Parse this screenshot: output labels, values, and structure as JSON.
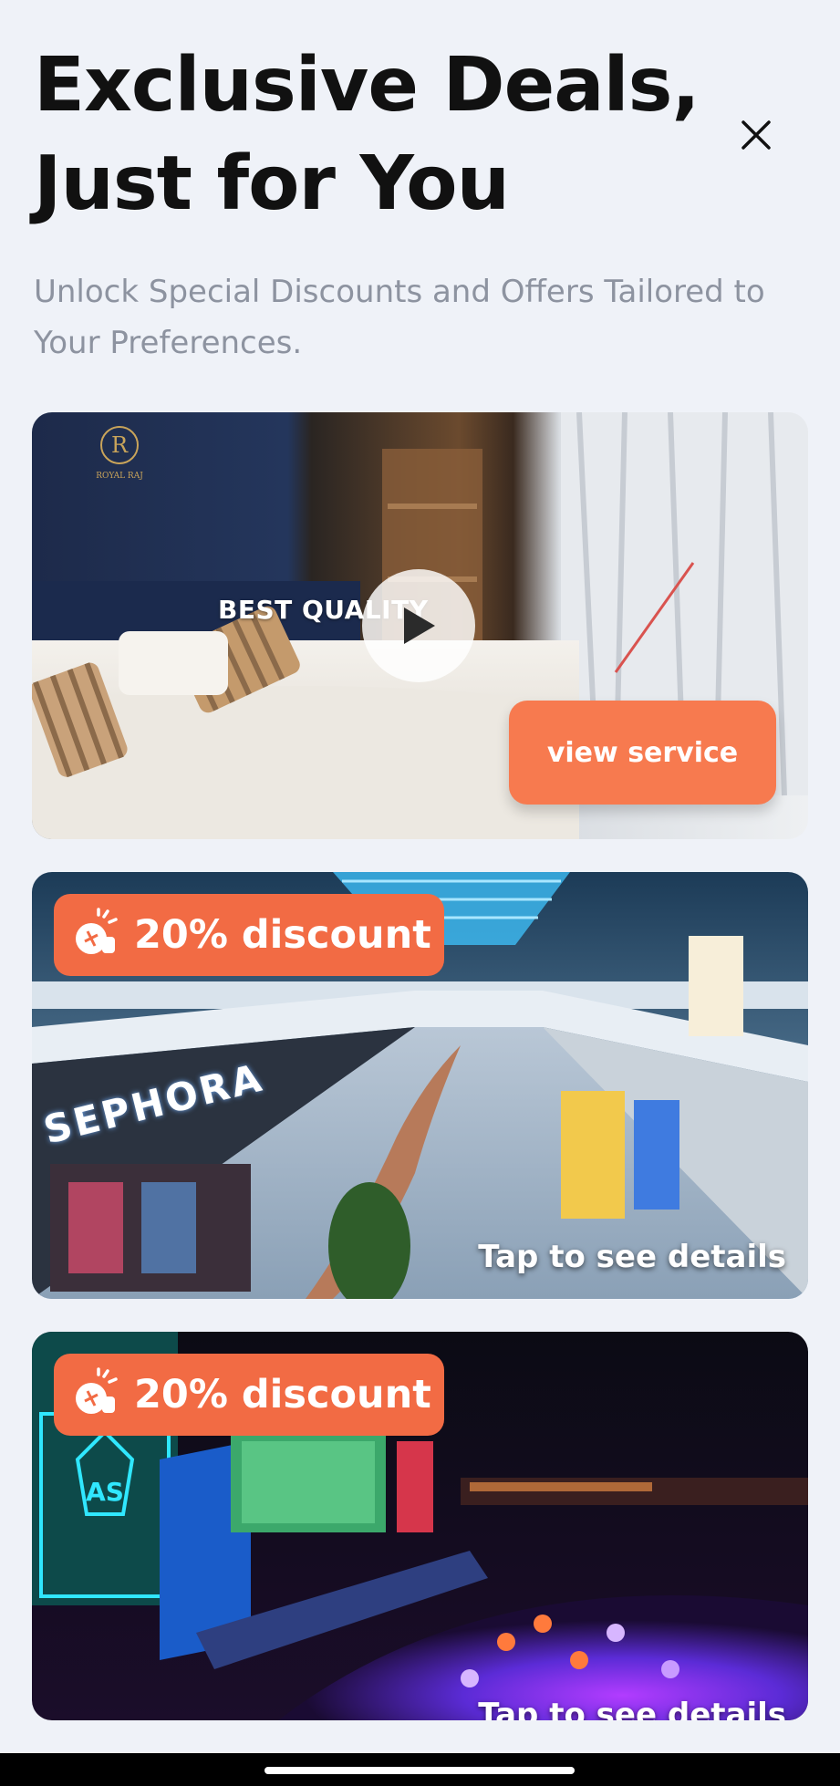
{
  "header": {
    "title": "Exclusive Deals, Just for You",
    "subtitle": "Unlock Special Discounts and Offers Tailored to Your Preferences.",
    "close_icon": "close-icon"
  },
  "cards": [
    {
      "image_text": "BEST QUALITY",
      "logo_text": "ROYAL RAJ",
      "action_label": "view service",
      "play_icon": "play-icon"
    },
    {
      "badge": "20% discount",
      "badge_icon": "discount-hand-icon",
      "tap_text": "Tap to see details",
      "store_sign": "SEPHORA"
    },
    {
      "badge": "20% discount",
      "badge_icon": "discount-hand-icon",
      "tap_text": "Tap to see details"
    }
  ],
  "colors": {
    "accent": "#f26b44",
    "background": "#eff2f8",
    "subtitle": "#8d93a0"
  }
}
